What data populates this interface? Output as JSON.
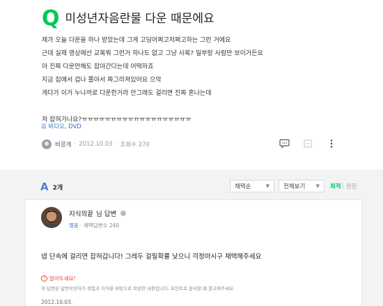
{
  "question": {
    "mark": "Q",
    "title": "미성년자음란물 다운 때문에요",
    "lines": [
      "제가 오늘 다운을 하나 받았는데 그게 고딩어쩌고저쩌고하는 그런 거에요",
      "근데 실제 영상에선 교복뭐 그런거 하나도 없고 그냥 사복? 일부랑 사람만 보이거든요",
      "아 진짜 다운만해도 잡아간다는데 어떡하죠",
      "지금 집에서 겁나 쫄아서 짜그라져있어요 으악",
      "게다가 이거 누나꺼로 다운한거라 안그래도 걸리면 진짜 혼나는데",
      "저 잡혀가나요?ㅠㅠㅠㅠㅠㅠㅠㅠㅠㅠㅠㅠㅠㅠㅠㅠㅠㅠㅠ"
    ],
    "category": "☰ 비디오, DVD",
    "author": "비공개",
    "date": "2012.10.03",
    "views": "조회수 270"
  },
  "answers_bar": {
    "icon": "A",
    "count": "2개",
    "sort_select": "채택순",
    "filter_select": "전체보기",
    "sort_latest": "최적",
    "sort_newest": "원문"
  },
  "answer": {
    "name": "지식의끝",
    "suffix": "님 답변",
    "level": "영웅",
    "adopted": "채택답변수 240",
    "text": "넵 단속에 걸리면 잡혀갑니다! 그레두 걸릴확률 낮으니 걱정마시구 채택해주세요",
    "notice_title": "알아두세요!",
    "notice_text": "위 답변은 답변작성자가 경험과 지식을 바탕으로 작성한 내용입니다. 포인트로 감사할 때 참고해주세요.",
    "date": "2012.10.03."
  },
  "colors": {
    "brand": "#03c75a",
    "link": "#2b70c9",
    "warning": "#e0443a"
  }
}
